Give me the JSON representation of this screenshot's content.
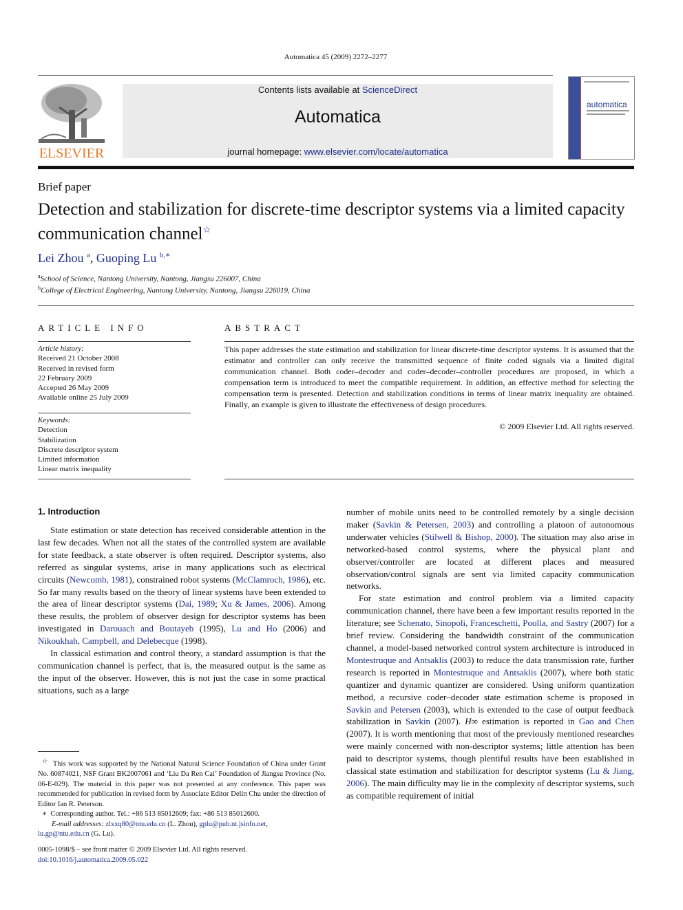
{
  "header": {
    "journal_ref": "Automatica 45 (2009) 2272–2277",
    "contents_prefix": "Contents lists available at ",
    "contents_link": "ScienceDirect",
    "journal_name": "Automatica",
    "homepage_prefix": "journal homepage: ",
    "homepage_link": "www.elsevier.com/locate/automatica",
    "publisher_logo_text": "ELSEVIER",
    "cover_title": "automatica",
    "colors": {
      "publisher_orange": "#e87722",
      "link_blue": "#1f2f8a",
      "banner_gray": "#ebebeb"
    }
  },
  "article": {
    "type": "Brief paper",
    "title": "Detection and stabilization for discrete-time descriptor systems via a limited capacity communication channel",
    "title_note_mark": "☆",
    "authors": [
      {
        "name": "Lei Zhou",
        "sup": "a"
      },
      {
        "name": "Guoping Lu",
        "sup": "b,∗"
      }
    ],
    "author_separator": ", ",
    "affiliations": [
      {
        "sup": "a",
        "text": "School of Science, Nantong University, Nantong, Jiangsu 226007, China"
      },
      {
        "sup": "b",
        "text": "College of Electrical Engineering, Nantong University, Nantong, Jiangsu 226019, China"
      }
    ]
  },
  "article_info": {
    "heading": "ARTICLE INFO",
    "history_label": "Article history:",
    "history": [
      "Received 21 October 2008",
      "Received in revised form",
      "22 February 2009",
      "Accepted 26 May 2009",
      "Available online 25 July 2009"
    ],
    "keywords_label": "Keywords:",
    "keywords": [
      "Detection",
      "Stabilization",
      "Discrete descriptor system",
      "Limited information",
      "Linear matrix inequality"
    ]
  },
  "abstract": {
    "heading": "ABSTRACT",
    "text": "This paper addresses the state estimation and stabilization for linear discrete-time descriptor systems. It is assumed that the estimator and controller can only receive the transmitted sequence of finite coded signals via a limited digital communication channel. Both coder–decoder and coder–decoder–controller procedures are proposed, in which a compensation term is introduced to meet the compatible requirement. In addition, an effective method for selecting the compensation term is presented. Detection and stabilization conditions in terms of linear matrix inequality are obtained. Finally, an example is given to illustrate the effectiveness of design procedures.",
    "copyright": "© 2009 Elsevier Ltd. All rights reserved."
  },
  "intro": {
    "heading": "1.  Introduction",
    "p1": {
      "t1": "State estimation or state detection has received considerable attention in the last few decades. When not all the states of the controlled system are available for state feedback, a state observer is often required. Descriptor systems, also referred as singular systems, arise in many applications such as electrical circuits (",
      "c1": "Newcomb, 1981",
      "t2": "), constrained robot systems (",
      "c2": "McClamroch, 1986",
      "t3": "), etc. So far many results based on the theory of linear systems have been extended to the area of linear descriptor systems (",
      "c3": "Dai, 1989",
      "t4": "; ",
      "c4": "Xu & James, 2006",
      "t5": "). Among these results, the problem of observer design for descriptor systems has been investigated in ",
      "c5": "Darouach and Boutayeb",
      "t6": " (1995), ",
      "c6": "Lu and Ho",
      "t7": " (2006) and ",
      "c7": "Nikoukhah, Campbell, and Delebecque",
      "t8": " (1998)."
    },
    "p2": {
      "t1": "In classical estimation and control theory, a standard assumption is that the communication channel is perfect, that is, the measured output is the same as the input of the observer. However, this is not just the case in some practical situations, such as a large number of mobile units need to be controlled remotely by a single decision maker (",
      "c1": "Savkin & Petersen, 2003",
      "t2": ") and controlling a platoon of autonomous underwater vehicles (",
      "c2": "Stilwell & Bishop, 2000",
      "t3": "). The situation may also arise in networked-based control systems, where the physical plant and observer/controller are located at different places and measured observation/control signals are sent via limited capacity communication networks."
    },
    "p2_left": "In classical estimation and control theory, a standard assumption is that the communication channel is perfect, that is, the measured output is the same as the input of the observer. However, this is not just the case in some practical situations, such as a large",
    "p2_right": {
      "t1": "number of mobile units need to be controlled remotely by a single decision maker (",
      "c1": "Savkin & Petersen, 2003",
      "t2": ") and controlling a platoon of autonomous underwater vehicles (",
      "c2": "Stilwell & Bishop, 2000",
      "t3": "). The situation may also arise in networked-based control systems, where the physical plant and observer/controller are located at different places and measured observation/control signals are sent via limited capacity communication networks."
    },
    "p3": {
      "t1": "For state estimation and control problem via a limited capacity communication channel, there have been a few important results reported in the literature; see ",
      "c1": "Schenato, Sinopoli, Franceschetti, Poolla, and Sastry",
      "t2": " (2007) for a brief review. Considering the bandwidth constraint of the communication channel, a model-based networked control system architecture is introduced in ",
      "c2": "Montestruque and Antsaklis",
      "t3": " (2003) to reduce the data transmission rate, further research is reported in ",
      "c3": "Montestruque and Antsaklis",
      "t4": " (2007), where both static quantizer and dynamic quantizer are considered. Using uniform quantization method, a recursive coder–decoder state estimation scheme is proposed in ",
      "c4": "Savkin and Petersen",
      "t5": " (2003), which is extended to the case of output feedback stabilization in ",
      "c5": "Savkin",
      "t6": " (2007). ",
      "math": "H∞",
      "t7": " estimation is reported in ",
      "c6": "Gao and Chen",
      "t8": " (2007). It is worth mentioning that most of the previously mentioned researches were mainly concerned with non-descriptor systems; little attention has been paid to descriptor systems, though plentiful results have been established in classical state estimation and stabilization for descriptor systems (",
      "c7": "Lu & Jiang, 2006",
      "t9": "). The main difficulty may lie in the complexity of descriptor systems, such as compatible requirement of initial"
    }
  },
  "footnotes": {
    "star_mark": "☆",
    "funding": "This work was supported by the National Natural Science Foundation of China under Grant No. 60874021, NSF Grant BK2007061 and ‘Liu Da Ren Cai’ Foundation of Jiangsu Province (No. 06-E-029). The material in this paper was not presented at any conference. This paper was recommended for publication in revised form by Associate Editor Delin Chu under the direction of Editor Ian R. Peterson.",
    "corr_mark": "∗",
    "corresponding": "Corresponding author. Tel.: +86 513 85012609; fax: +86 513 85012600.",
    "email_label": "E-mail addresses:",
    "email1": "zlxxq80@ntu.edu.cn",
    "email1_owner": " (L. Zhou), ",
    "email2": "gplu@pub.nt.jsinfo.net",
    "email_sep": ",",
    "email3": "lu.gp@ntu.edu.cn",
    "email3_owner": " (G. Lu)."
  },
  "front_matter": {
    "issn_line": "0005-1098/$ – see front matter © 2009 Elsevier Ltd. All rights reserved.",
    "doi": "doi:10.1016/j.automatica.2009.05.022"
  }
}
